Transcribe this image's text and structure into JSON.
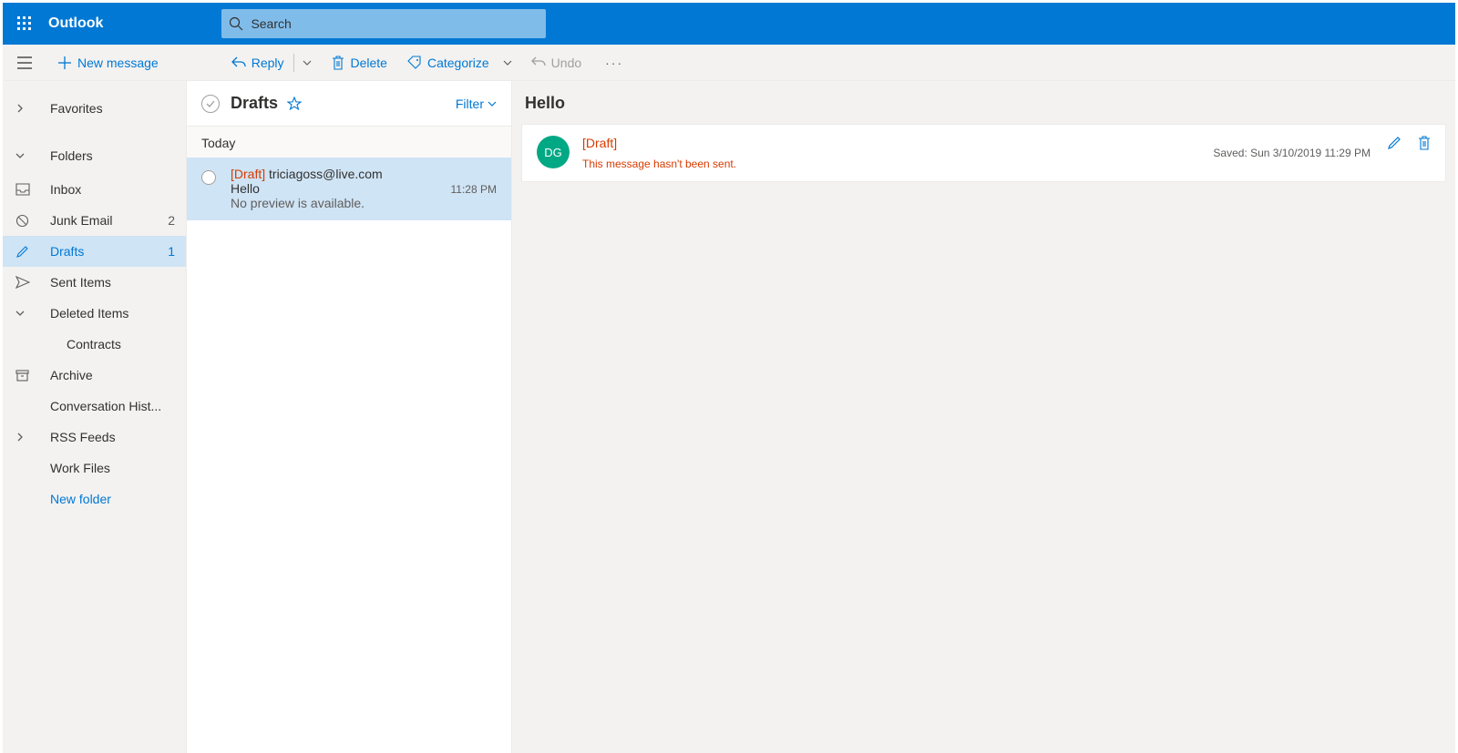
{
  "header": {
    "app_name": "Outlook",
    "search_placeholder": "Search"
  },
  "toolbar": {
    "new_message": "New message",
    "reply": "Reply",
    "delete": "Delete",
    "categorize": "Categorize",
    "undo": "Undo"
  },
  "sidebar": {
    "favorites": "Favorites",
    "folders_label": "Folders",
    "folders": [
      {
        "name": "Inbox",
        "count": "",
        "icon": "inbox"
      },
      {
        "name": "Junk Email",
        "count": "2",
        "icon": "junk"
      },
      {
        "name": "Drafts",
        "count": "1",
        "icon": "draft",
        "active": true
      },
      {
        "name": "Sent Items",
        "count": "",
        "icon": "sent"
      },
      {
        "name": "Deleted Items",
        "count": "",
        "icon": "chev"
      },
      {
        "name": "Contracts",
        "count": "",
        "icon": "",
        "child": true
      },
      {
        "name": "Archive",
        "count": "",
        "icon": "archive"
      },
      {
        "name": "Conversation Hist...",
        "count": "",
        "icon": ""
      },
      {
        "name": "RSS Feeds",
        "count": "",
        "icon": "chevr"
      },
      {
        "name": "Work Files",
        "count": "",
        "icon": ""
      }
    ],
    "new_folder": "New folder"
  },
  "list": {
    "title": "Drafts",
    "filter": "Filter",
    "group": "Today",
    "messages": [
      {
        "draft_tag": "[Draft]",
        "to": "triciagoss@live.com",
        "subject": "Hello",
        "time": "11:28 PM",
        "preview": "No preview is available."
      }
    ]
  },
  "reader": {
    "subject": "Hello",
    "avatar_initials": "DG",
    "draft_tag": "[Draft]",
    "not_sent": "This message hasn't been sent.",
    "saved": "Saved: Sun 3/10/2019 11:29 PM"
  }
}
